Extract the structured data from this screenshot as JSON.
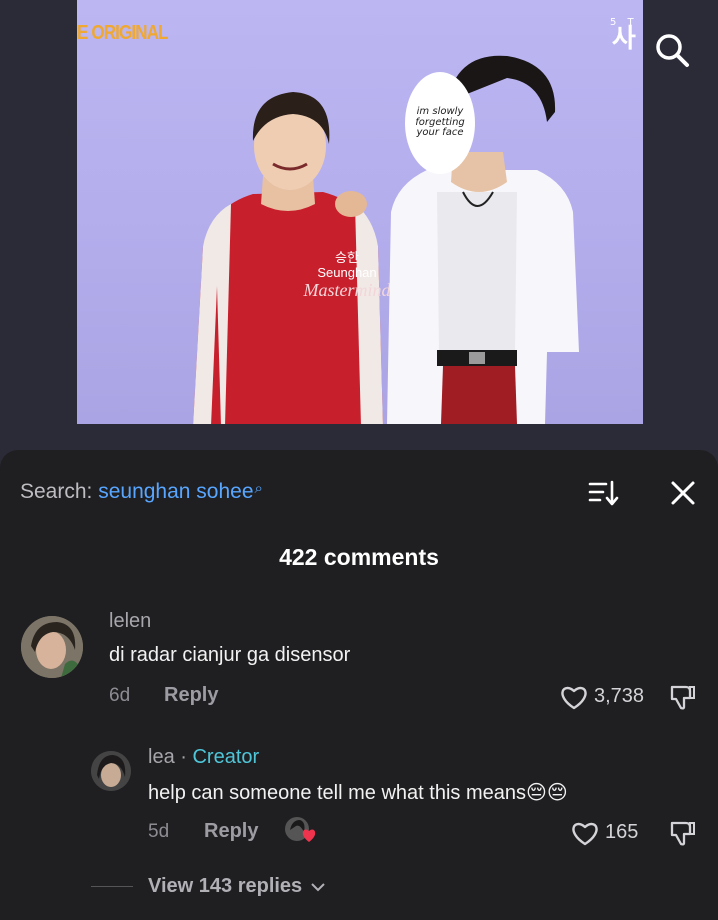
{
  "video": {
    "brand_tag": "E ORIGINAL",
    "watermark_small": "5 T",
    "watermark_big": "사",
    "shirt_korean": "승한",
    "shirt_name": "Seunghan",
    "shirt_script": "Mastermind",
    "face_cover_text": "im slowly forgetting your face",
    "icons": {
      "search": "search-icon"
    }
  },
  "panel": {
    "search_label": "Search: ",
    "search_query": "seunghan sohee",
    "search_query_icon": "⌕",
    "comment_count": "422 comments",
    "icons": {
      "sort": "sort-icon",
      "close": "close-icon"
    }
  },
  "comments": [
    {
      "username": "lelen",
      "text": "di radar cianjur ga disensor",
      "age": "6d",
      "reply_label": "Reply",
      "likes": "3,738",
      "avatar": "avatar-photo"
    }
  ],
  "reply": {
    "username": "lea",
    "separator": " · ",
    "badge": "Creator",
    "text": "help can someone tell me what this means😔😔",
    "age": "5d",
    "reply_label": "Reply",
    "likes": "165",
    "liked_by_creator": true
  },
  "view_replies": "View 143 replies",
  "colors": {
    "panel_bg": "#1f1f22",
    "accent_link": "#58a6ff",
    "creator": "#4fc6d8",
    "video_bg": "#b8b2ef",
    "shirt_red": "#c81f2d"
  }
}
